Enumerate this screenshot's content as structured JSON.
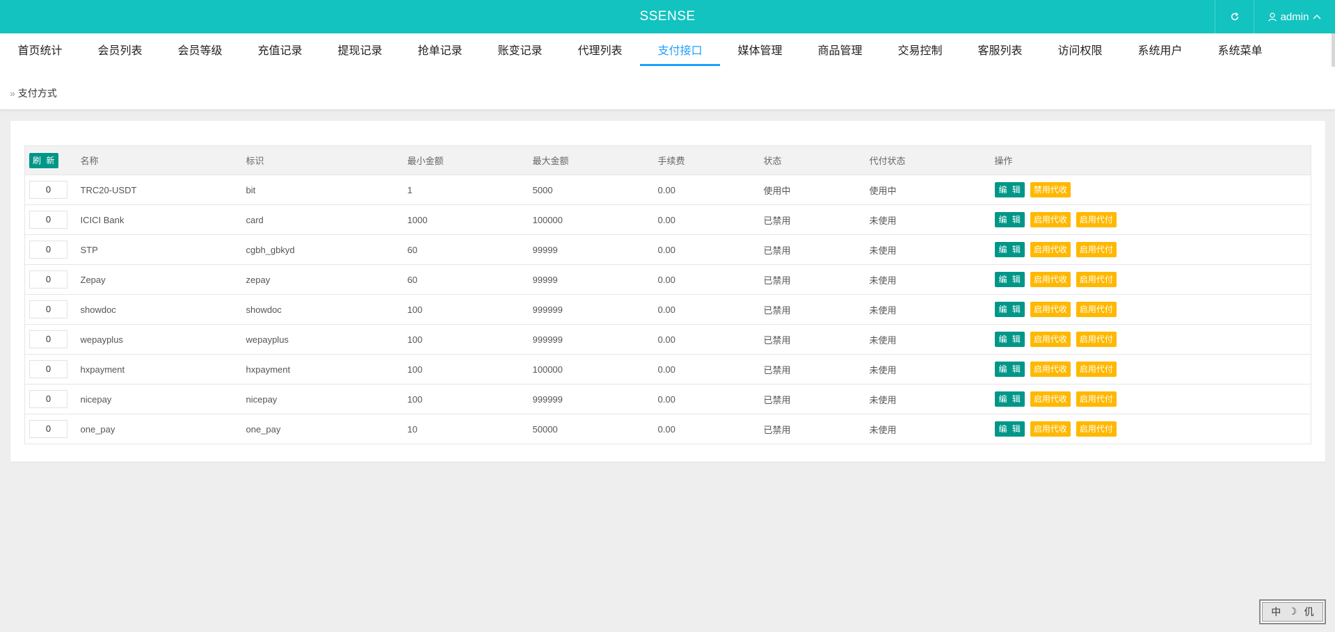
{
  "header": {
    "title": "SSENSE",
    "user": "admin"
  },
  "nav": [
    {
      "label": "首页统计"
    },
    {
      "label": "会员列表"
    },
    {
      "label": "会员等级"
    },
    {
      "label": "充值记录"
    },
    {
      "label": "提现记录"
    },
    {
      "label": "抢单记录"
    },
    {
      "label": "账变记录"
    },
    {
      "label": "代理列表"
    },
    {
      "label": "支付接口",
      "active": true
    },
    {
      "label": "媒体管理"
    },
    {
      "label": "商品管理"
    },
    {
      "label": "交易控制"
    },
    {
      "label": "客服列表"
    },
    {
      "label": "访问权限"
    },
    {
      "label": "系统用户"
    },
    {
      "label": "系统菜单"
    }
  ],
  "breadcrumb": {
    "current": "支付方式"
  },
  "table": {
    "refresh_label": "刷 新",
    "headers": {
      "name": "名称",
      "code": "标识",
      "min": "最小金额",
      "max": "最大金额",
      "fee": "手续费",
      "status": "状态",
      "payout_status": "代付状态",
      "actions": "操作"
    },
    "rows": [
      {
        "sort": "0",
        "name": "TRC20-USDT",
        "code": "bit",
        "min": "1",
        "max": "5000",
        "fee": "0.00",
        "status": "使用中",
        "payout_status": "使用中",
        "actions": [
          "编 辑",
          "禁用代收"
        ]
      },
      {
        "sort": "0",
        "name": "ICICI Bank",
        "code": "card",
        "min": "1000",
        "max": "100000",
        "fee": "0.00",
        "status": "已禁用",
        "payout_status": "未使用",
        "actions": [
          "编 辑",
          "启用代收",
          "启用代付"
        ]
      },
      {
        "sort": "0",
        "name": "STP",
        "code": "cgbh_gbkyd",
        "min": "60",
        "max": "99999",
        "fee": "0.00",
        "status": "已禁用",
        "payout_status": "未使用",
        "actions": [
          "编 辑",
          "启用代收",
          "启用代付"
        ]
      },
      {
        "sort": "0",
        "name": "Zepay",
        "code": "zepay",
        "min": "60",
        "max": "99999",
        "fee": "0.00",
        "status": "已禁用",
        "payout_status": "未使用",
        "actions": [
          "编 辑",
          "启用代收",
          "启用代付"
        ]
      },
      {
        "sort": "0",
        "name": "showdoc",
        "code": "showdoc",
        "min": "100",
        "max": "999999",
        "fee": "0.00",
        "status": "已禁用",
        "payout_status": "未使用",
        "actions": [
          "编 辑",
          "启用代收",
          "启用代付"
        ]
      },
      {
        "sort": "0",
        "name": "wepayplus",
        "code": "wepayplus",
        "min": "100",
        "max": "999999",
        "fee": "0.00",
        "status": "已禁用",
        "payout_status": "未使用",
        "actions": [
          "编 辑",
          "启用代收",
          "启用代付"
        ]
      },
      {
        "sort": "0",
        "name": "hxpayment",
        "code": "hxpayment",
        "min": "100",
        "max": "100000",
        "fee": "0.00",
        "status": "已禁用",
        "payout_status": "未使用",
        "actions": [
          "编 辑",
          "启用代收",
          "启用代付"
        ]
      },
      {
        "sort": "0",
        "name": "nicepay",
        "code": "nicepay",
        "min": "100",
        "max": "999999",
        "fee": "0.00",
        "status": "已禁用",
        "payout_status": "未使用",
        "actions": [
          "编 辑",
          "启用代收",
          "启用代付"
        ]
      },
      {
        "sort": "0",
        "name": "one_pay",
        "code": "one_pay",
        "min": "10",
        "max": "50000",
        "fee": "0.00",
        "status": "已禁用",
        "payout_status": "未使用",
        "actions": [
          "编 辑",
          "启用代收",
          "启用代付"
        ]
      }
    ]
  },
  "ime": {
    "chars": [
      "中",
      "☽",
      "仉"
    ]
  },
  "colors": {
    "topbar": "#12c3c0",
    "active": "#1e9fff",
    "green": "#009688",
    "yellow": "#ffb800",
    "on": "#009f00",
    "off": "#ff2d2d"
  }
}
